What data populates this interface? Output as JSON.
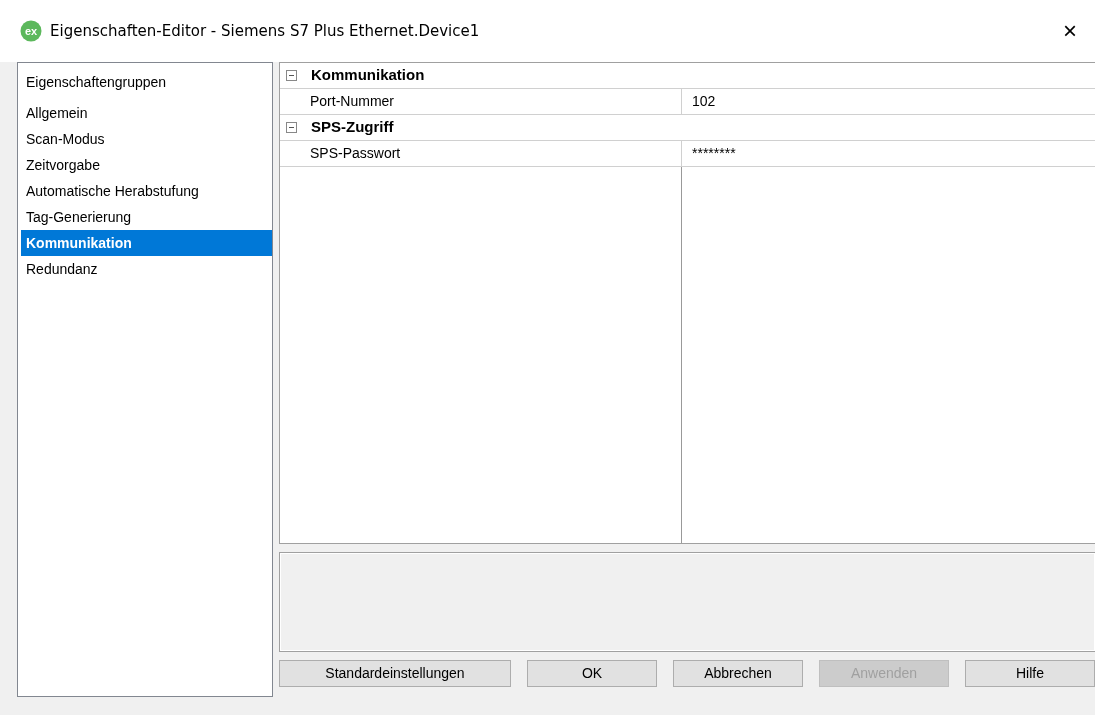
{
  "window": {
    "logo": "ex",
    "title": "Eigenschaften-Editor - Siemens S7 Plus Ethernet.Device1",
    "close": "×"
  },
  "groups": {
    "header": "Eigenschaftengruppen",
    "items": [
      {
        "label": "Allgemein",
        "selected": false
      },
      {
        "label": "Scan-Modus",
        "selected": false
      },
      {
        "label": "Zeitvorgabe",
        "selected": false
      },
      {
        "label": "Automatische Herabstufung",
        "selected": false
      },
      {
        "label": "Tag-Generierung",
        "selected": false
      },
      {
        "label": "Kommunikation",
        "selected": true
      },
      {
        "label": "Redundanz",
        "selected": false
      }
    ]
  },
  "properties": [
    {
      "category": "Kommunikation",
      "expanded": true,
      "rows": [
        {
          "name": "Port-Nummer",
          "value": "102"
        }
      ]
    },
    {
      "category": "SPS-Zugriff",
      "expanded": true,
      "rows": [
        {
          "name": "SPS-Passwort",
          "value": "********"
        }
      ]
    }
  ],
  "buttons": [
    {
      "label": "Standardeinstellungen",
      "disabled": false
    },
    {
      "label": "OK",
      "disabled": false
    },
    {
      "label": "Abbrechen",
      "disabled": false
    },
    {
      "label": "Anwenden",
      "disabled": true
    },
    {
      "label": "Hilfe",
      "disabled": false
    }
  ]
}
